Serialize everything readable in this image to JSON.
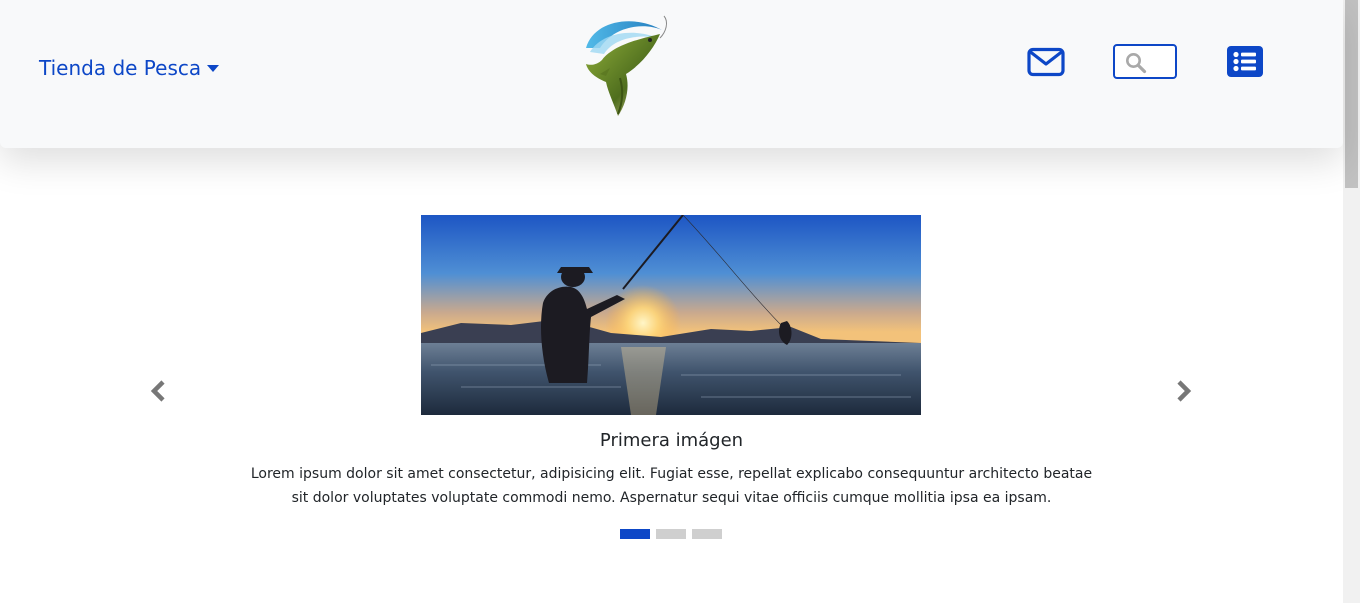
{
  "navbar": {
    "brand_label": "Tienda de Pesca",
    "logo_icon": "jumping-bass-fish-logo",
    "mail_icon": "envelope-icon",
    "search": {
      "icon": "magnifier-icon",
      "value": ""
    },
    "menu_icon": "list-icon"
  },
  "carousel": {
    "image": "fisherman-silhouette-at-sunset",
    "caption_title": "Primera imágen",
    "caption_text": "Lorem ipsum dolor sit amet consectetur, adipisicing elit. Fugiat esse, repellat explicabo consequuntur architecto beatae sit dolor voluptates voluptate commodi nemo. Aspernatur sequi vitae officiis cumque mollitia ipsa ea ipsam.",
    "slide_count": 3,
    "active_slide": 1
  },
  "colors": {
    "accent": "#0d47c7",
    "navbar_bg": "#f8f9fa",
    "indicator_inactive": "#cfcfcf",
    "arrow": "#777777"
  }
}
